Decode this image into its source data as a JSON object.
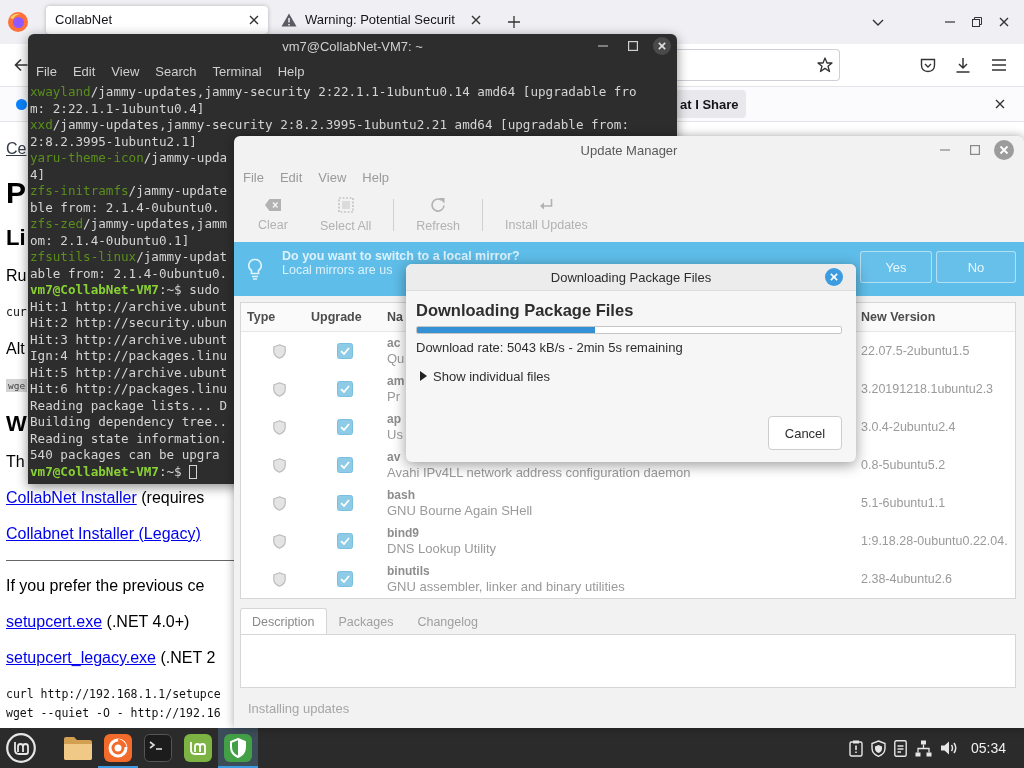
{
  "browser": {
    "tabs": [
      {
        "label": "CollabNet",
        "selected": true
      },
      {
        "label": "Warning: Potential Securit",
        "selected": false
      }
    ],
    "notification": {
      "button": "at I Share"
    },
    "page": {
      "lines": [
        {
          "kind": "crumb",
          "text": "Ce"
        },
        {
          "kind": "h1",
          "text": "P"
        },
        {
          "kind": "h2",
          "text": "Li"
        },
        {
          "kind": "para",
          "text": "Ru"
        },
        {
          "kind": "code",
          "lines": [
            "cur"
          ]
        },
        {
          "kind": "para",
          "text": "Alt"
        },
        {
          "kind": "shaded",
          "lines": [
            "wge"
          ]
        },
        {
          "kind": "h2",
          "text": "W"
        },
        {
          "kind": "para",
          "text": "Th"
        },
        {
          "kind": "link-line",
          "link": "CollabNet Installer",
          "text": "(requires"
        },
        {
          "kind": "link-line",
          "link": "Collabnet Installer (Legacy)"
        },
        {
          "kind": "rule"
        },
        {
          "kind": "para",
          "text": "If you prefer the previous ce"
        },
        {
          "kind": "link-line",
          "link": "setupcert.exe",
          "text": "(.NET 4.0+)"
        },
        {
          "kind": "link-line",
          "link": "setupcert_legacy.exe",
          "text": "(.NET 2"
        },
        {
          "kind": "code",
          "lines": [
            "curl http://192.168.1.1/setupce",
            "wget --quiet -O - http://192.16"
          ]
        }
      ]
    }
  },
  "terminal": {
    "title": "vm7@CollabNet-VM7: ~",
    "menu": [
      "File",
      "Edit",
      "View",
      "Search",
      "Terminal",
      "Help"
    ],
    "lines": [
      {
        "kind": "package",
        "name": "xwayland",
        "text": "/jammy-updates,jammy-security 2:22.1.1-1ubuntu0.14 amd64 [upgradable fro"
      },
      {
        "kind": "output",
        "text": "m: 2:22.1.1-1ubuntu0.4]"
      },
      {
        "kind": "package",
        "name": "xxd",
        "text": "/jammy-updates,jammy-security 2:8.2.3995-1ubuntu2.21 amd64 [upgradable from:"
      },
      {
        "kind": "output",
        "text": "2:8.2.3995-1ubuntu2.1]"
      },
      {
        "kind": "package",
        "name": "yaru-theme-icon",
        "text": "/jammy-upda"
      },
      {
        "kind": "output",
        "text": "4]"
      },
      {
        "kind": "package",
        "name": "zfs-initramfs",
        "text": "/jammy-update"
      },
      {
        "kind": "output",
        "text": "ble from: 2.1.4-0ubuntu0."
      },
      {
        "kind": "package",
        "name": "zfs-zed",
        "text": "/jammy-updates,jamm"
      },
      {
        "kind": "output",
        "text": "om: 2.1.4-0ubuntu0.1]"
      },
      {
        "kind": "package",
        "name": "zfsutils-linux",
        "text": "/jammy-updat"
      },
      {
        "kind": "output",
        "text": "able from: 2.1.4-0ubuntu0."
      },
      {
        "kind": "prompt",
        "user": "vm7@CollabNet-VM7",
        "text": ":~$ sudo",
        "cursor": false
      },
      {
        "kind": "output",
        "text": "Hit:1 http://archive.ubunt"
      },
      {
        "kind": "output",
        "text": "Hit:2 http://security.ubun"
      },
      {
        "kind": "output",
        "text": "Hit:3 http://archive.ubunt"
      },
      {
        "kind": "output",
        "text": "Ign:4 http://packages.linu"
      },
      {
        "kind": "output",
        "text": "Hit:5 http://archive.ubunt"
      },
      {
        "kind": "output",
        "text": "Hit:6 http://packages.linu"
      },
      {
        "kind": "output",
        "text": "Reading package lists... D"
      },
      {
        "kind": "output",
        "text": "Building dependency tree.."
      },
      {
        "kind": "output",
        "text": "Reading state information."
      },
      {
        "kind": "output",
        "text": "540 packages can be upgra"
      },
      {
        "kind": "prompt",
        "user": "vm7@CollabNet-VM7",
        "text": ":~$",
        "cursor": true
      }
    ]
  },
  "update_manager": {
    "title": "Update Manager",
    "menu": [
      "File",
      "Edit",
      "View",
      "Help"
    ],
    "toolbar": [
      {
        "label": "Clear",
        "disabled": true
      },
      {
        "label": "Select All",
        "disabled": true
      },
      {
        "label": "Refresh",
        "disabled": true
      },
      {
        "label": "Install Updates",
        "disabled": true
      }
    ],
    "infobar": {
      "title": "Do you want to switch to a local mirror?",
      "text": "Local mirrors are us",
      "buttons": [
        "Yes",
        "No"
      ]
    },
    "table": {
      "columns": [
        "Type",
        "Upgrade",
        "Na",
        "New Version"
      ],
      "rows": [
        {
          "checked": true,
          "name": "ac",
          "description": "Qu",
          "version": "22.07.5-2ubuntu1.5"
        },
        {
          "checked": true,
          "name": "am",
          "description": "Pr",
          "version": "3.20191218.1ubuntu2.3"
        },
        {
          "checked": true,
          "name": "ap",
          "description": "Us",
          "version": "3.0.4-2ubuntu2.4"
        },
        {
          "checked": true,
          "name": "av",
          "description": "Avahi IPv4LL network address configuration daemon",
          "version": "0.8-5ubuntu5.2"
        },
        {
          "checked": true,
          "name": "bash",
          "description": "GNU Bourne Again SHell",
          "version": "5.1-6ubuntu1.1"
        },
        {
          "checked": true,
          "name": "bind9",
          "description": "DNS Lookup Utility",
          "version": "1:9.18.28-0ubuntu0.22.04."
        },
        {
          "checked": true,
          "name": "binutils",
          "description": "GNU assembler, linker and binary utilities",
          "version": "2.38-4ubuntu2.6"
        }
      ]
    },
    "tabs": [
      {
        "label": "Description",
        "selected": true
      },
      {
        "label": "Packages",
        "selected": false
      },
      {
        "label": "Changelog",
        "selected": false
      }
    ],
    "status": "Installing updates"
  },
  "dialog": {
    "title": "Downloading Package Files",
    "heading": "Downloading Package Files",
    "level": 0.42,
    "rate": "Download rate: 5043 kB/s - 2min 5s remaining",
    "expander": {
      "label": "Show individual files",
      "expanded": false
    },
    "button": "Cancel"
  },
  "taskbar": {
    "apps": [
      {
        "running": false,
        "active": false
      },
      {
        "running": true,
        "active": false
      },
      {
        "running": false,
        "active": false
      },
      {
        "running": false,
        "active": false
      },
      {
        "running": true,
        "active": true
      }
    ],
    "clock": "05:34"
  }
}
